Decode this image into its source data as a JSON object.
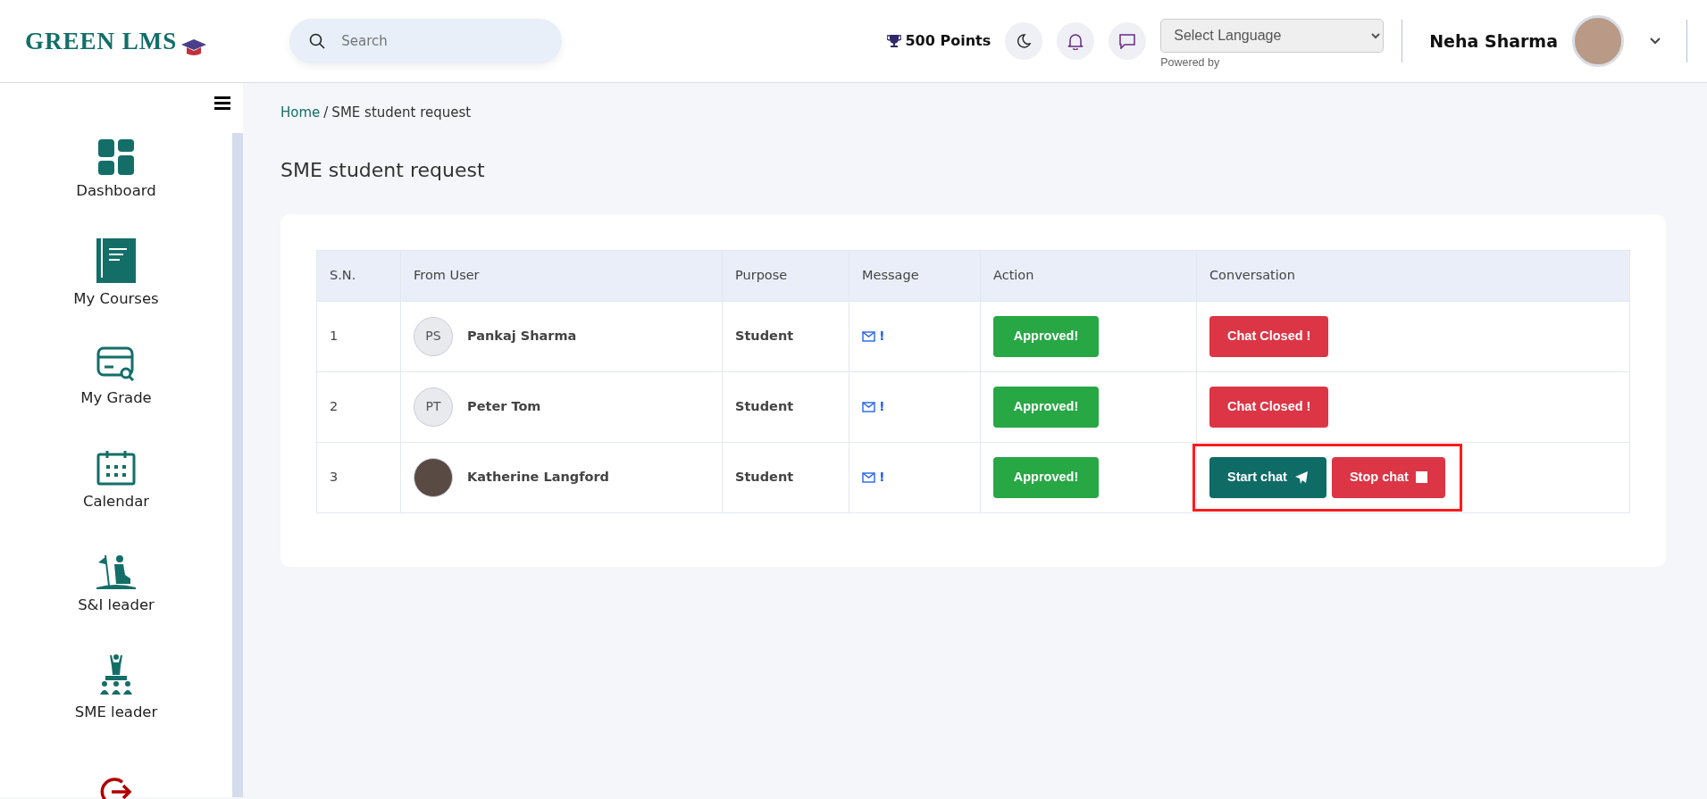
{
  "header": {
    "logo": "GREEN LMS",
    "search": {
      "placeholder": "Search"
    },
    "points": "500 Points",
    "language": {
      "placeholder": "Select Language",
      "note": "Powered by"
    },
    "user": {
      "name": "Neha Sharma"
    }
  },
  "sidebar": {
    "items": [
      {
        "kind": "dashboard",
        "label": "Dashboard"
      },
      {
        "kind": "courses",
        "label": "My Courses"
      },
      {
        "kind": "grade",
        "label": "My Grade"
      },
      {
        "kind": "calendar",
        "label": "Calendar"
      },
      {
        "kind": "sandi",
        "label": "S&I leader"
      },
      {
        "kind": "sme",
        "label": "SME leader"
      },
      {
        "kind": "logout"
      }
    ]
  },
  "breadcrumb": {
    "separator": "/",
    "items": [
      {
        "label": "Home",
        "link": true
      },
      {
        "label": "SME student request",
        "link": false
      }
    ]
  },
  "page_title": "SME student request",
  "table": {
    "columns": [
      "S.N.",
      "From User",
      "Purpose",
      "Message",
      "Action",
      "Conversation"
    ],
    "rows": [
      {
        "sn": "1",
        "user": {
          "kind": "initials",
          "initials": "PS",
          "name": "Pankaj Sharma"
        },
        "purpose": "Student",
        "message": "!",
        "action": "Approved!",
        "conversation": {
          "kind": "closed",
          "buttons": [
            "Chat Closed !"
          ]
        },
        "highlighted": false
      },
      {
        "sn": "2",
        "user": {
          "kind": "initials",
          "initials": "PT",
          "name": "Peter Tom"
        },
        "purpose": "Student",
        "message": "!",
        "action": "Approved!",
        "conversation": {
          "kind": "closed",
          "buttons": [
            "Chat Closed !"
          ]
        },
        "highlighted": false
      },
      {
        "sn": "3",
        "user": {
          "kind": "photo",
          "name": "Katherine Langford"
        },
        "purpose": "Student",
        "message": "!",
        "action": "Approved!",
        "conversation": {
          "kind": "open",
          "buttons": [
            "Start chat",
            "Stop chat"
          ]
        },
        "highlighted": true
      }
    ]
  }
}
